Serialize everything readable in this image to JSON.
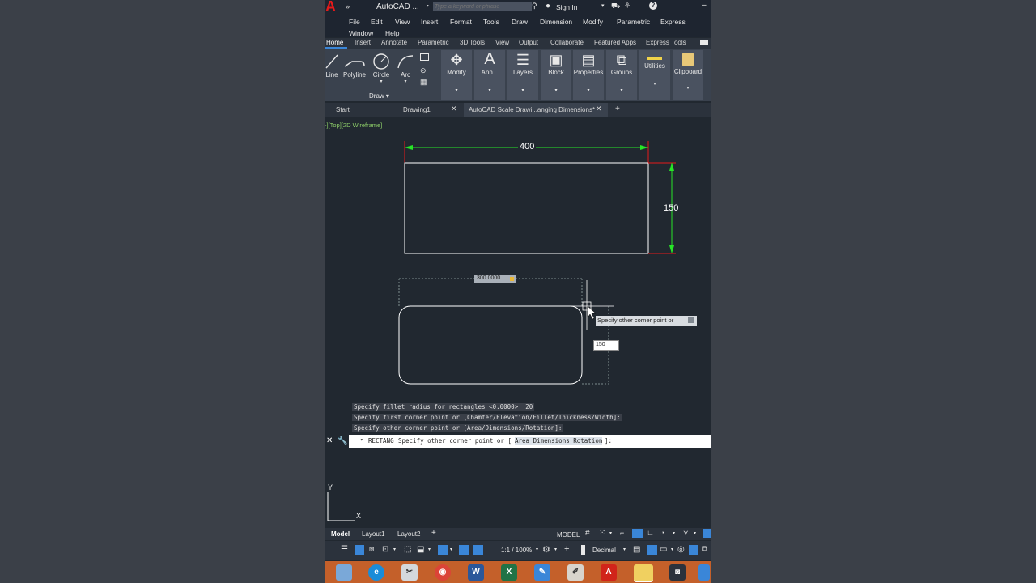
{
  "app": {
    "title": "AutoCAD ...",
    "logo": "A"
  },
  "search": {
    "placeholder": "Type a keyword or phrase"
  },
  "account": {
    "signin_label": "Sign In"
  },
  "menu": [
    "File",
    "Edit",
    "View",
    "Insert",
    "Format",
    "Tools",
    "Draw",
    "Dimension",
    "Modify",
    "Parametric",
    "Express",
    "Window",
    "Help"
  ],
  "ribbon_tabs": [
    "Home",
    "Insert",
    "Annotate",
    "Parametric",
    "3D Tools",
    "View",
    "Output",
    "Collaborate",
    "Featured Apps",
    "Express Tools"
  ],
  "draw_tools": [
    "Line",
    "Polyline",
    "Circle",
    "Arc"
  ],
  "draw_panel_label": "Draw",
  "panels": [
    "Modify",
    "Ann...",
    "Layers",
    "Block",
    "Properties",
    "Groups",
    "Utilities",
    "Clipboard"
  ],
  "file_tabs": {
    "start": "Start",
    "drawing1": "Drawing1",
    "active": "AutoCAD Scale Drawi...anging Dimensions*"
  },
  "viewport_label": "-][Top][2D Wireframe]",
  "dims": {
    "width": "400",
    "height": "150"
  },
  "dyn_input": {
    "x_value": "300.0000",
    "prompt": "Specify other corner point or",
    "y_value": "150"
  },
  "command_history": [
    "Specify fillet radius for rectangles <0.0000>: 20",
    "Specify first corner point or [Chamfer/Elevation/Fillet/Thickness/Width]:",
    "Specify other corner point or [Area/Dimensions/Rotation]:"
  ],
  "command_line": {
    "cmd": "RECTANG",
    "prompt": "Specify other corner point or [",
    "options": "Area Dimensions Rotation",
    "end": "]:"
  },
  "ucs": {
    "x": "X",
    "y": "Y"
  },
  "layout_tabs": [
    "Model",
    "Layout1",
    "Layout2"
  ],
  "status": {
    "model": "MODEL",
    "scale": "1:1 / 100%",
    "units": "Decimal"
  },
  "colors": {
    "accent": "#e51a1a",
    "dim_line": "#27e627",
    "taskbar": "#c4602a",
    "canvas": "#212830"
  }
}
